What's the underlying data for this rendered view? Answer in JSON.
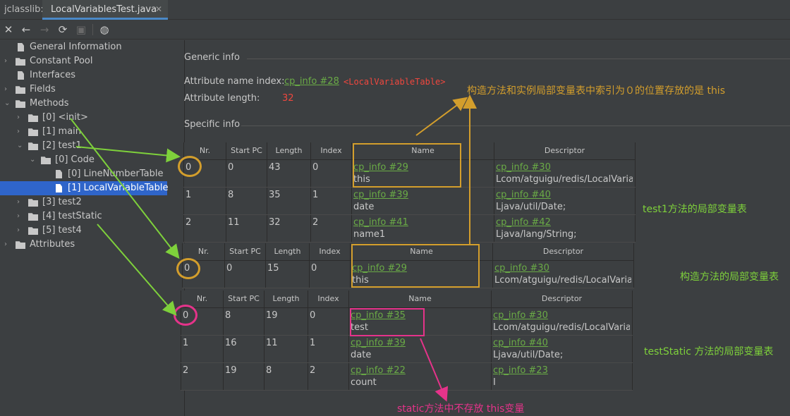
{
  "app": {
    "name": "jclasslib:",
    "tab": "LocalVariablesTest.java"
  },
  "tree": [
    {
      "label": "General Information",
      "kind": "file",
      "depth": 0,
      "arrow": ""
    },
    {
      "label": "Constant Pool",
      "kind": "folder",
      "depth": 0,
      "arrow": "›"
    },
    {
      "label": "Interfaces",
      "kind": "file",
      "depth": 0,
      "arrow": ""
    },
    {
      "label": "Fields",
      "kind": "folder",
      "depth": 0,
      "arrow": "›"
    },
    {
      "label": "Methods",
      "kind": "folder",
      "depth": 0,
      "arrow": "⌄"
    },
    {
      "label": "[0] <init>",
      "kind": "folder",
      "depth": 1,
      "arrow": "›"
    },
    {
      "label": "[1] main",
      "kind": "folder",
      "depth": 1,
      "arrow": "›"
    },
    {
      "label": "[2] test1",
      "kind": "folder",
      "depth": 1,
      "arrow": "⌄"
    },
    {
      "label": "[0] Code",
      "kind": "folder",
      "depth": 2,
      "arrow": "⌄"
    },
    {
      "label": "[0] LineNumberTable",
      "kind": "file",
      "depth": 3,
      "arrow": ""
    },
    {
      "label": "[1] LocalVariableTable",
      "kind": "file",
      "depth": 3,
      "arrow": "",
      "selected": true
    },
    {
      "label": "[3] test2",
      "kind": "folder",
      "depth": 1,
      "arrow": "›"
    },
    {
      "label": "[4] testStatic",
      "kind": "folder",
      "depth": 1,
      "arrow": "›"
    },
    {
      "label": "[5] test4",
      "kind": "folder",
      "depth": 1,
      "arrow": "›"
    },
    {
      "label": "Attributes",
      "kind": "folder",
      "depth": 0,
      "arrow": "›"
    }
  ],
  "generic": {
    "title": "Generic info",
    "name_index_label": "Attribute name index:",
    "name_index_link": "cp_info #28",
    "name_index_tag": "<LocalVariableTable>",
    "length_label": "Attribute length:",
    "length_value": "32"
  },
  "specific": {
    "title": "Specific info"
  },
  "columns": [
    "Nr.",
    "Start PC",
    "Length",
    "Index",
    "Name",
    "Descriptor"
  ],
  "tables": [
    {
      "rows": [
        {
          "nr": "0",
          "start": "0",
          "length": "43",
          "index": "0",
          "name_link": "cp_info #29",
          "name": "this",
          "desc_link": "cp_info #30",
          "desc": "Lcom/atguigu/redis/LocalVariable"
        },
        {
          "nr": "1",
          "start": "8",
          "length": "35",
          "index": "1",
          "name_link": "cp_info #39",
          "name": "date",
          "desc_link": "cp_info #40",
          "desc": "Ljava/util/Date;"
        },
        {
          "nr": "2",
          "start": "11",
          "length": "32",
          "index": "2",
          "name_link": "cp_info #41",
          "name": "name1",
          "desc_link": "cp_info #42",
          "desc": "Ljava/lang/String;"
        }
      ]
    },
    {
      "rows": [
        {
          "nr": "0",
          "start": "0",
          "length": "15",
          "index": "0",
          "name_link": "cp_info #29",
          "name": "this",
          "desc_link": "cp_info #30",
          "desc": "Lcom/atguigu/redis/LocalVariablesTest;"
        }
      ]
    },
    {
      "rows": [
        {
          "nr": "0",
          "start": "8",
          "length": "19",
          "index": "0",
          "name_link": "cp_info #35",
          "name": "test",
          "desc_link": "cp_info #30",
          "desc": "Lcom/atguigu/redis/LocalVariable"
        },
        {
          "nr": "1",
          "start": "16",
          "length": "11",
          "index": "1",
          "name_link": "cp_info #39",
          "name": "date",
          "desc_link": "cp_info #40",
          "desc": "Ljava/util/Date;"
        },
        {
          "nr": "2",
          "start": "19",
          "length": "8",
          "index": "2",
          "name_link": "cp_info #22",
          "name": "count",
          "desc_link": "cp_info #23",
          "desc": "I"
        }
      ]
    }
  ],
  "annotations": {
    "top": "构造方法和实例局部变量表中索引为０的位置存放的是 this",
    "test1": "test1方法的局部变量表",
    "init": "构造方法的局部变量表",
    "testStatic": "testStatic 方法的局部变量表",
    "static_note": "static方法中不存放 this变量"
  },
  "colors": {
    "link": "#6aab46",
    "tag": "#f0473e",
    "orange": "#d39e2c",
    "green": "#7ed13b",
    "pink": "#e5338a",
    "selection": "#2f65ca"
  }
}
